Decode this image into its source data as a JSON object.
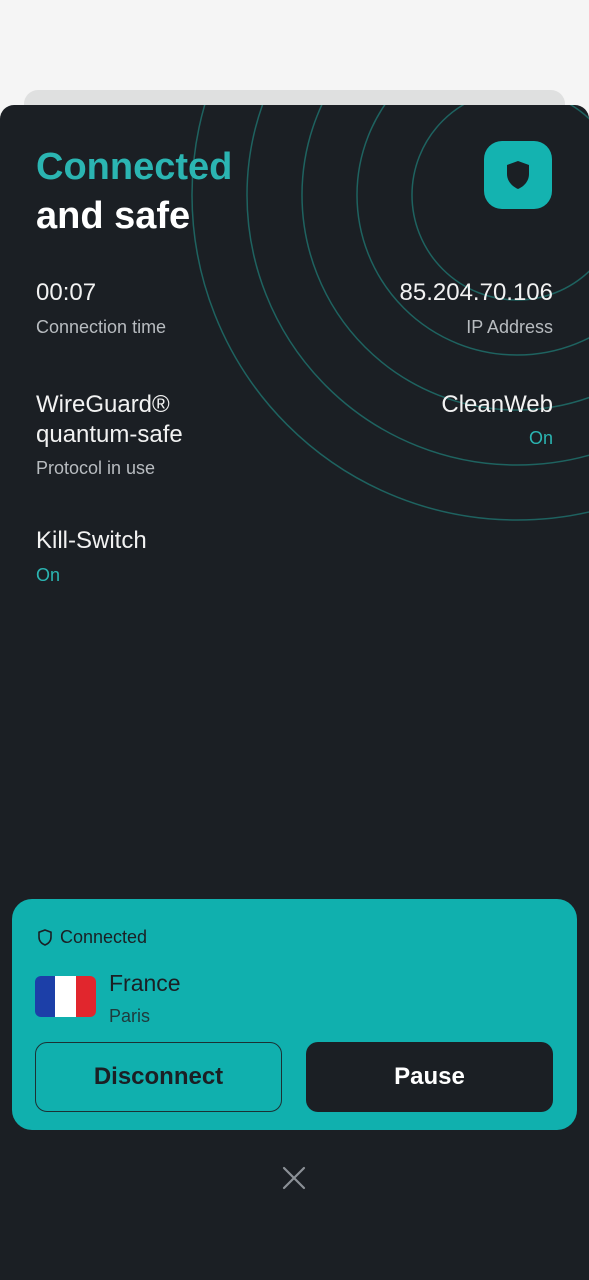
{
  "header": {
    "title_line1": "Connected",
    "title_line2": "and safe"
  },
  "stats": {
    "connection_time": {
      "value": "00:07",
      "label": "Connection time"
    },
    "ip_address": {
      "value": "85.204.70.106",
      "label": "IP Address"
    },
    "protocol": {
      "value_line1": "WireGuard®",
      "value_line2": "quantum-safe",
      "label": "Protocol in use"
    },
    "cleanweb": {
      "value": "CleanWeb",
      "status": "On"
    },
    "kill_switch": {
      "value": "Kill-Switch",
      "status": "On"
    }
  },
  "card": {
    "status": "Connected",
    "country": "France",
    "city": "Paris",
    "disconnect_label": "Disconnect",
    "pause_label": "Pause"
  },
  "colors": {
    "accent": "#2bb5b2",
    "card_bg": "#10b0ae",
    "dark_bg": "#1b1f24",
    "flag_blue": "#1c3fa8",
    "flag_white": "#ffffff",
    "flag_red": "#e1262d"
  },
  "icons": {
    "badge": "shield-icon",
    "status": "shield-outline-icon",
    "close": "close-icon"
  }
}
